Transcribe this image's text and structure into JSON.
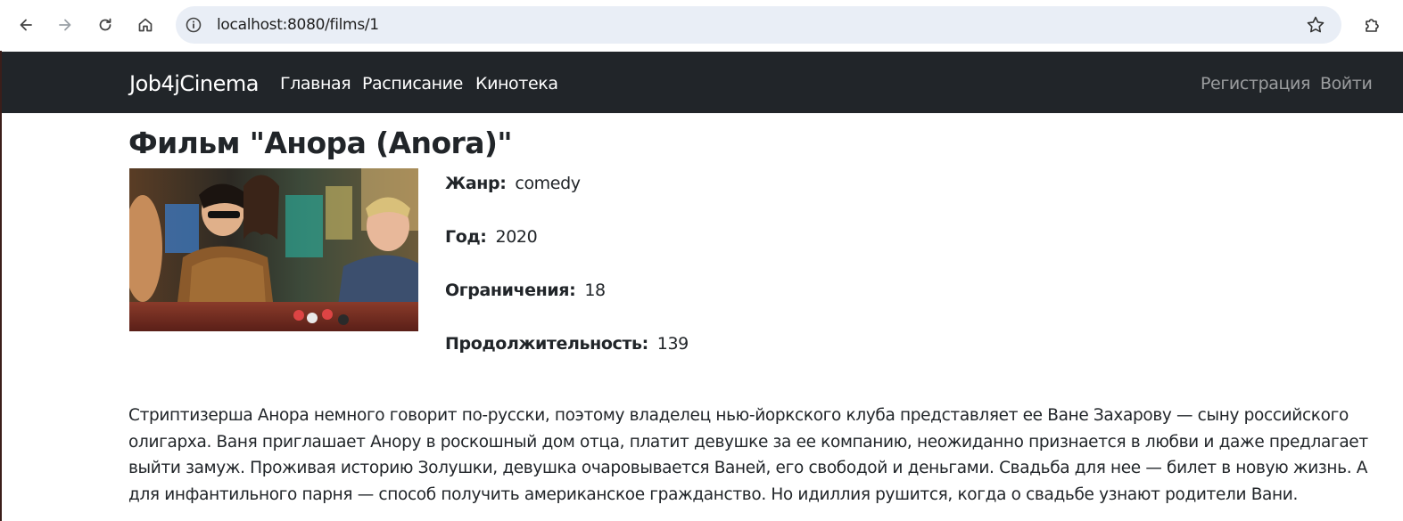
{
  "browser": {
    "url": "localhost:8080/films/1"
  },
  "navbar": {
    "brand": "Job4jCinema",
    "links": [
      "Главная",
      "Расписание",
      "Кинотека"
    ],
    "register": "Регистрация",
    "login": "Войти"
  },
  "film": {
    "title": "Фильм \"Анора (Anora)\"",
    "poster_icon": "poster-image",
    "genre_label": "Жанр:",
    "genre": "comedy",
    "year_label": "Год:",
    "year": "2020",
    "age_label": "Ограничения:",
    "age": "18",
    "duration_label": "Продолжительность:",
    "duration": "139",
    "description": "Стриптизерша Анора немного говорит по-русски, поэтому владелец нью-йоркского клуба представляет ее Ване Захарову — сыну российского олигарха. Ваня приглашает Анору в роскошный дом отца, платит девушке за ее компанию, неожиданно признается в любви и даже предлагает выйти замуж. Проживая историю Золушки, девушка очаровывается Ваней, его свободой и деньгами. Свадьба для нее — билет в новую жизнь. А для инфантильного парня — способ получить американское гражданство. Но идиллия рушится, когда о свадьбе узнают родители Вани."
  },
  "colors": {
    "navbar_bg": "#212529",
    "omnibox_bg": "#e9eef6",
    "text": "#212529"
  }
}
